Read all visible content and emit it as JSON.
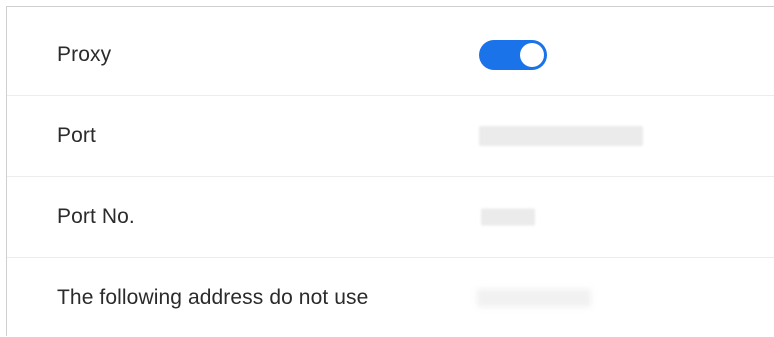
{
  "settings": {
    "rows": [
      {
        "label": "Proxy",
        "control": "toggle",
        "toggle_on": true
      },
      {
        "label": "Port",
        "control": "redacted-value"
      },
      {
        "label": "Port No.",
        "control": "redacted-value"
      },
      {
        "label": "The following address do not use",
        "control": "redacted-value"
      }
    ]
  },
  "colors": {
    "toggle_on": "#1a73e8",
    "label_text": "#2b2b2b",
    "divider": "#ececec",
    "redacted": "#ebebeb"
  }
}
